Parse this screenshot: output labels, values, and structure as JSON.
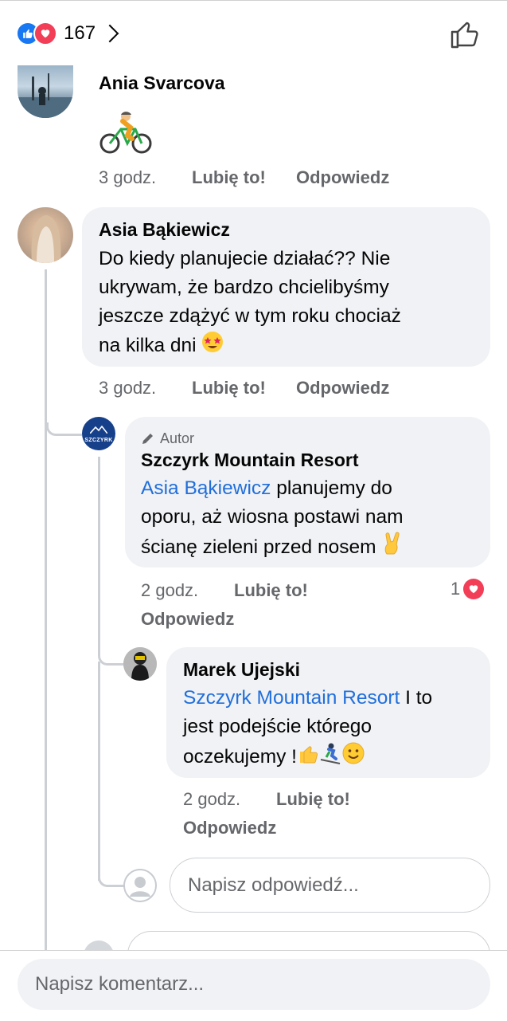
{
  "header": {
    "reaction_count": "167"
  },
  "comments": [
    {
      "author": "Ania Svarcova",
      "time": "3 godz.",
      "like": "Lubię to!",
      "reply": "Odpowiedz"
    },
    {
      "author": "Asia Bąkiewicz",
      "text_lines": [
        "Do kiedy planujecie działać?? Nie",
        "ukrywam, że bardzo chcielibyśmy",
        "jeszcze zdążyć w tym roku chociaż",
        "na kilka dni"
      ],
      "time": "3 godz.",
      "like": "Lubię to!",
      "reply": "Odpowiedz"
    }
  ],
  "replies": [
    {
      "badge": "Autor",
      "author": "Szczyrk Mountain Resort",
      "mention": "Asia Bąkiewicz",
      "text_lines": [
        " planujemy do",
        "oporu, aż wiosna postawi nam",
        "ścianę zieleni przed nosem"
      ],
      "time": "2 godz.",
      "like": "Lubię to!",
      "reply": "Odpowiedz",
      "reaction_count": "1",
      "avatar_text": "SZCZYRK"
    },
    {
      "author": "Marek Ujejski",
      "mention": "Szczyrk Mountain Resort",
      "text_lines": [
        " I to",
        "jest podejście którego",
        "oczekujemy !"
      ],
      "time": "2 godz.",
      "like": "Lubię to!",
      "reply": "Odpowiedz"
    }
  ],
  "reply_input": {
    "placeholder": "Napisz odpowiedź..."
  },
  "comment_input": {
    "placeholder": "Napisz komentarz..."
  },
  "colors": {
    "link": "#216fdb",
    "like_blue": "#1877f2",
    "love_red": "#f33e58",
    "bubble": "#f0f2f5",
    "meta": "#65676b"
  }
}
